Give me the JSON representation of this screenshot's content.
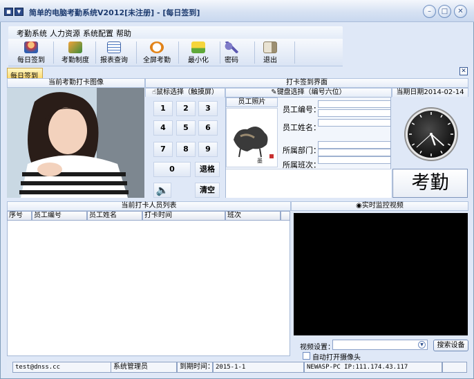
{
  "window": {
    "title": "简单的电脑考勤系统V2012[未注册] - [每日签到]",
    "min_glyph": "–",
    "max_glyph": "□",
    "close_glyph": "✕"
  },
  "menu": [
    "考勤系统",
    "人力资源",
    "系统配置",
    "帮助"
  ],
  "toolbar": [
    {
      "label": "每日签到",
      "icon": "user-checkin-icon"
    },
    {
      "label": "考勤制度",
      "icon": "rules-icon"
    },
    {
      "label": "报表查询",
      "icon": "report-icon"
    },
    {
      "label": "全屏考勤",
      "icon": "clock-icon"
    },
    {
      "label": "最小化",
      "icon": "minimize-down-icon"
    },
    {
      "label": "密码",
      "icon": "key-icon"
    },
    {
      "label": "退出",
      "icon": "exit-door-icon"
    }
  ],
  "tab": {
    "label": "每日签到",
    "close": "✕"
  },
  "photo_section": {
    "title": "当前考勤打卡图像"
  },
  "checkin_section": {
    "title": "打卡签到界面"
  },
  "mouse_select": "鼠标选择（触摸屏）",
  "keyboard_select": "键盘选择（编号六位）",
  "date_label": "当期日期2014-02-14",
  "keypad": {
    "keys": [
      "1",
      "2",
      "3",
      "4",
      "5",
      "6",
      "7",
      "8",
      "9",
      "0"
    ],
    "backspace": "退格",
    "clear": "清空"
  },
  "employee": {
    "photo_title": "员工照片",
    "id_label": "员工编号：",
    "name_label": "员工姓名：",
    "dept_label": "所属部门：",
    "shift_label": "所属班次："
  },
  "kaoqin_button": "考勤",
  "clock": {
    "hour": 5,
    "minute": 22,
    "second": 38
  },
  "list": {
    "title": "当前打卡人员列表",
    "columns": [
      "序号",
      "员工编号",
      "员工姓名",
      "打卡时间",
      "班次"
    ]
  },
  "video": {
    "title": "实时监控视频",
    "setting_label": "视频设置：",
    "search_button": "搜索设备",
    "auto_open": "自动打开摄像头"
  },
  "status": {
    "email": "test@dnss.cc",
    "role": "系统管理员",
    "expire_label": "到期时间：",
    "expire_value": "2015-1-1",
    "host": "NEWASP-PC IP:111.174.43.117"
  }
}
